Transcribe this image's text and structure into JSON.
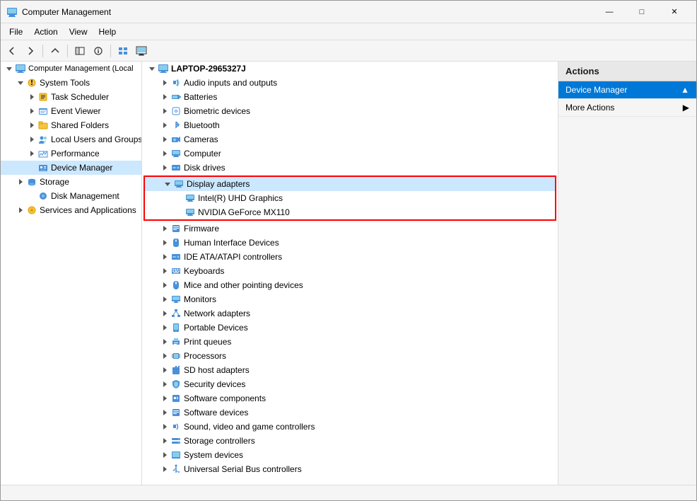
{
  "window": {
    "title": "Computer Management",
    "controls": {
      "minimize": "—",
      "maximize": "□",
      "close": "✕"
    }
  },
  "menubar": {
    "items": [
      "File",
      "Action",
      "View",
      "Help"
    ]
  },
  "toolbar": {
    "buttons": [
      "←",
      "→",
      "⬆",
      "📋",
      "🔧",
      "▶",
      "⬛",
      "🖥"
    ]
  },
  "left_pane": {
    "root_label": "Computer Management (Local",
    "items": [
      {
        "id": "system-tools",
        "label": "System Tools",
        "level": 1,
        "expanded": true
      },
      {
        "id": "task-scheduler",
        "label": "Task Scheduler",
        "level": 2
      },
      {
        "id": "event-viewer",
        "label": "Event Viewer",
        "level": 2
      },
      {
        "id": "shared-folders",
        "label": "Shared Folders",
        "level": 2
      },
      {
        "id": "local-users",
        "label": "Local Users and Groups",
        "level": 2
      },
      {
        "id": "performance",
        "label": "Performance",
        "level": 2
      },
      {
        "id": "device-manager",
        "label": "Device Manager",
        "level": 2,
        "selected": true
      },
      {
        "id": "storage",
        "label": "Storage",
        "level": 1,
        "expanded": false
      },
      {
        "id": "disk-management",
        "label": "Disk Management",
        "level": 2
      },
      {
        "id": "services",
        "label": "Services and Applications",
        "level": 1,
        "expanded": false
      }
    ]
  },
  "middle_pane": {
    "computer_label": "LAPTOP-2965327J",
    "items": [
      {
        "id": "audio",
        "label": "Audio inputs and outputs",
        "level": 1,
        "expanded": false
      },
      {
        "id": "batteries",
        "label": "Batteries",
        "level": 1,
        "expanded": false
      },
      {
        "id": "biometric",
        "label": "Biometric devices",
        "level": 1,
        "expanded": false
      },
      {
        "id": "bluetooth",
        "label": "Bluetooth",
        "level": 1,
        "expanded": false
      },
      {
        "id": "cameras",
        "label": "Cameras",
        "level": 1,
        "expanded": false
      },
      {
        "id": "computer",
        "label": "Computer",
        "level": 1,
        "expanded": false
      },
      {
        "id": "disk-drives",
        "label": "Disk drives",
        "level": 1,
        "expanded": false
      },
      {
        "id": "display-adapters",
        "label": "Display adapters",
        "level": 1,
        "expanded": true,
        "highlighted": true
      },
      {
        "id": "intel-uhd",
        "label": "Intel(R) UHD Graphics",
        "level": 2,
        "highlighted": true
      },
      {
        "id": "nvidia",
        "label": "NVIDIA GeForce MX110",
        "level": 2,
        "highlighted": true
      },
      {
        "id": "firmware",
        "label": "Firmware",
        "level": 1,
        "expanded": false
      },
      {
        "id": "hid",
        "label": "Human Interface Devices",
        "level": 1,
        "expanded": false
      },
      {
        "id": "ide",
        "label": "IDE ATA/ATAPI controllers",
        "level": 1,
        "expanded": false
      },
      {
        "id": "keyboards",
        "label": "Keyboards",
        "level": 1,
        "expanded": false
      },
      {
        "id": "mice",
        "label": "Mice and other pointing devices",
        "level": 1,
        "expanded": false
      },
      {
        "id": "monitors",
        "label": "Monitors",
        "level": 1,
        "expanded": false
      },
      {
        "id": "network",
        "label": "Network adapters",
        "level": 1,
        "expanded": false
      },
      {
        "id": "portable",
        "label": "Portable Devices",
        "level": 1,
        "expanded": false
      },
      {
        "id": "print-queues",
        "label": "Print queues",
        "level": 1,
        "expanded": false
      },
      {
        "id": "processors",
        "label": "Processors",
        "level": 1,
        "expanded": false
      },
      {
        "id": "sd-host",
        "label": "SD host adapters",
        "level": 1,
        "expanded": false
      },
      {
        "id": "security",
        "label": "Security devices",
        "level": 1,
        "expanded": false
      },
      {
        "id": "software-components",
        "label": "Software components",
        "level": 1,
        "expanded": false
      },
      {
        "id": "software-devices",
        "label": "Software devices",
        "level": 1,
        "expanded": false
      },
      {
        "id": "sound-video",
        "label": "Sound, video and game controllers",
        "level": 1,
        "expanded": false
      },
      {
        "id": "storage-ctrl",
        "label": "Storage controllers",
        "level": 1,
        "expanded": false
      },
      {
        "id": "system-devices",
        "label": "System devices",
        "level": 1,
        "expanded": false
      },
      {
        "id": "usb",
        "label": "Universal Serial Bus controllers",
        "level": 1,
        "expanded": false
      }
    ]
  },
  "right_pane": {
    "header": "Actions",
    "items": [
      {
        "id": "device-manager-action",
        "label": "Device Manager",
        "active": true,
        "has_arrow": true
      },
      {
        "id": "more-actions",
        "label": "More Actions",
        "has_arrow": true
      }
    ]
  },
  "status_bar": {
    "text": ""
  }
}
